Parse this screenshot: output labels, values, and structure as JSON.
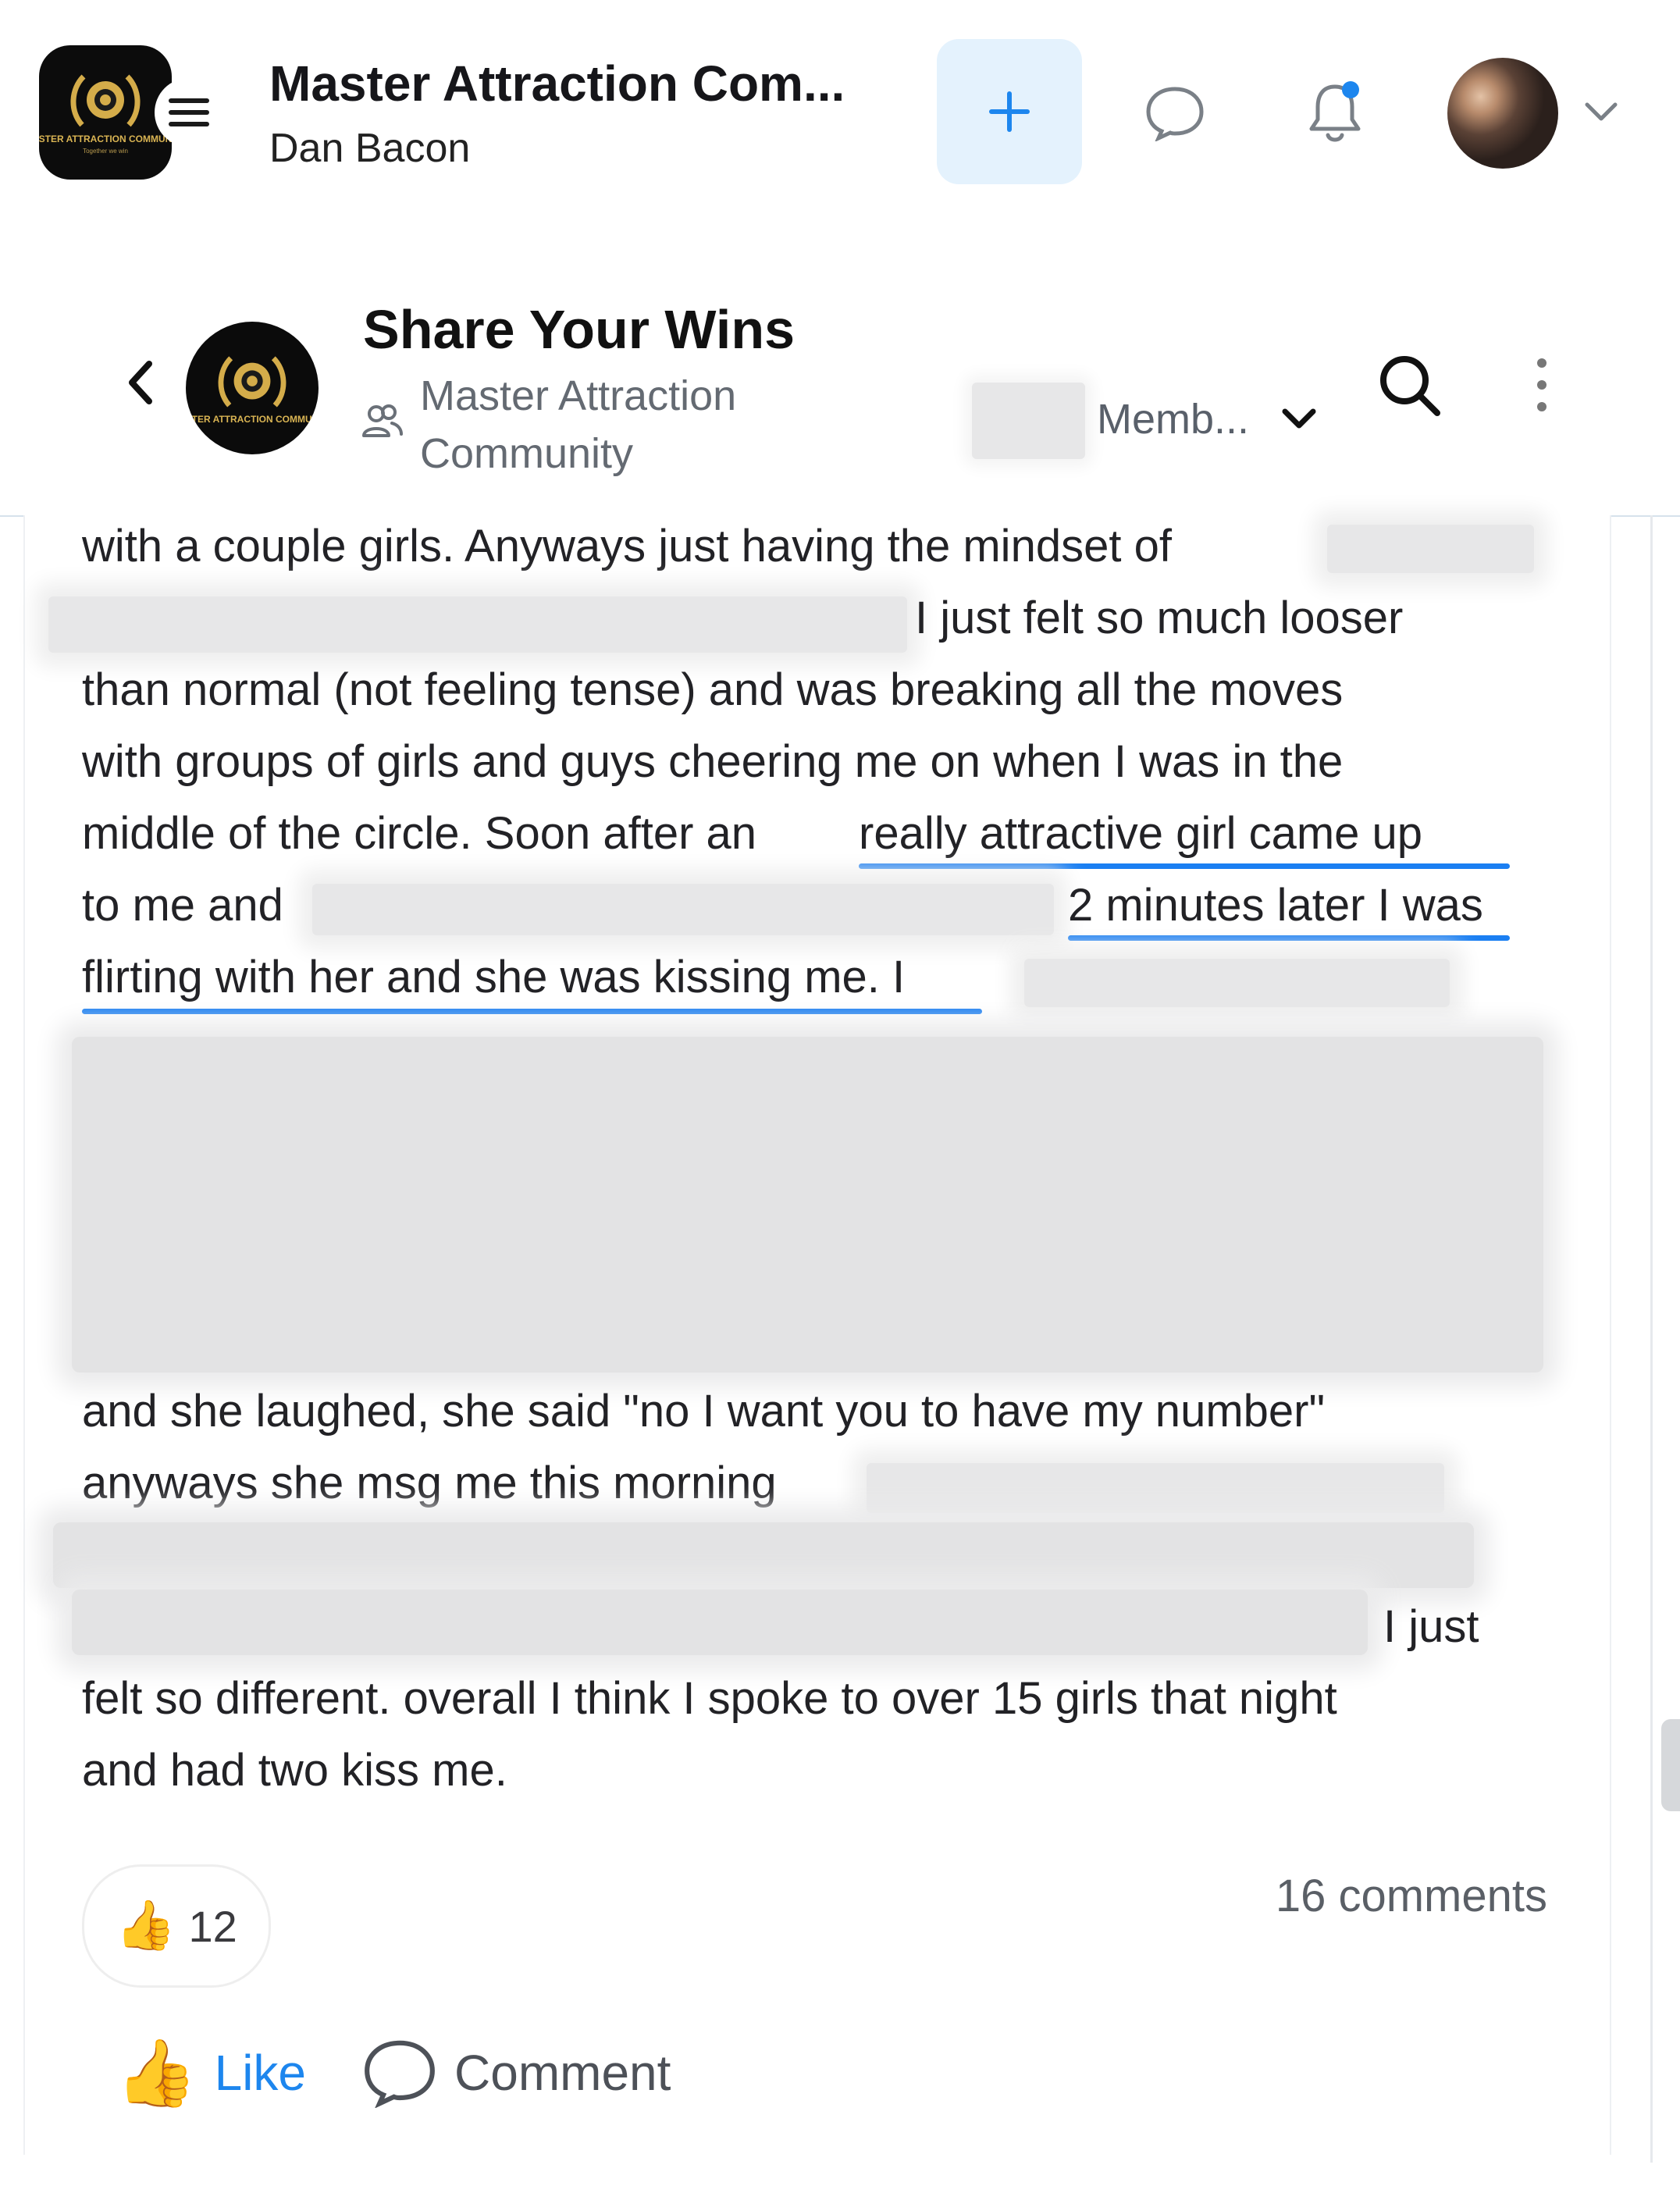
{
  "header": {
    "logo_text": "MASTER ATTRACTION COMMUNITY",
    "logo_tagline": "Together we win",
    "app_title": "Master Attraction Com...",
    "app_subtitle": "Dan Bacon",
    "icons": {
      "menu": "hamburger-icon",
      "create": "plus-icon",
      "chat": "chat-bubble-icon",
      "notifications": "bell-icon",
      "account_menu": "chevron-down-icon"
    },
    "notification_dot_color": "#1d86ee"
  },
  "channel": {
    "title": "Share Your Wins",
    "space_line1": "Master Attraction",
    "space_line2": "Community",
    "member_filter": "Memb...",
    "logo_text": "MASTER ATTRACTION COMMUNITY",
    "icons": {
      "back": "chevron-left-icon",
      "space": "people-icon",
      "search": "search-icon",
      "more": "vertical-dots-icon"
    }
  },
  "post": {
    "lines": [
      "with a couple girls. Anyways just having the mindset of",
      "I just felt so much looser",
      "than normal (not feeling tense) and was breaking all the moves",
      "with groups of girls and guys cheering me on when I was in the",
      "middle of the circle. Soon after an",
      "really attractive girl came up",
      "to me and",
      "2 minutes later I was",
      "flirting with her and she was kissing me. I",
      "and she laughed, she said \"no I want you to have my number\"",
      "anyways she msg me this morning",
      "I just",
      "felt so different. overall I think I spoke to over 15 girls that night",
      "and had two kiss me."
    ],
    "accent_color": "#1b7ff2"
  },
  "reactions": {
    "like_emoji": "👍",
    "like_count": "12",
    "comments": "16 comments"
  },
  "actions": {
    "like_label": "Like",
    "comment_label": "Comment"
  }
}
